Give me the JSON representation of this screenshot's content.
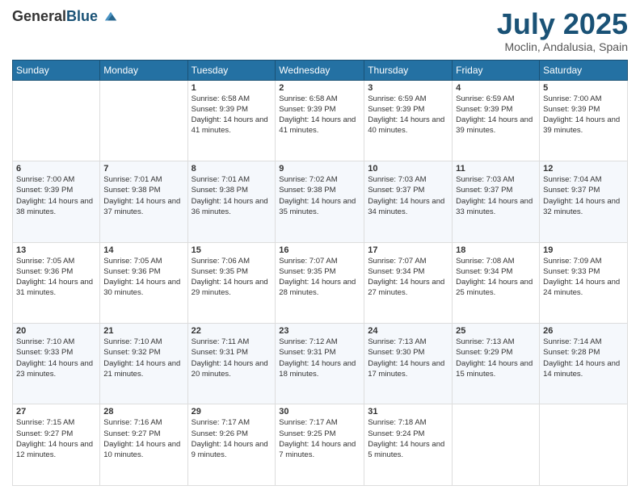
{
  "header": {
    "logo": {
      "general": "General",
      "blue": "Blue"
    },
    "title": "July 2025",
    "location": "Moclin, Andalusia, Spain"
  },
  "weekdays": [
    "Sunday",
    "Monday",
    "Tuesday",
    "Wednesday",
    "Thursday",
    "Friday",
    "Saturday"
  ],
  "weeks": [
    [
      {
        "day": "",
        "sunrise": "",
        "sunset": "",
        "daylight": ""
      },
      {
        "day": "",
        "sunrise": "",
        "sunset": "",
        "daylight": ""
      },
      {
        "day": "1",
        "sunrise": "Sunrise: 6:58 AM",
        "sunset": "Sunset: 9:39 PM",
        "daylight": "Daylight: 14 hours and 41 minutes."
      },
      {
        "day": "2",
        "sunrise": "Sunrise: 6:58 AM",
        "sunset": "Sunset: 9:39 PM",
        "daylight": "Daylight: 14 hours and 41 minutes."
      },
      {
        "day": "3",
        "sunrise": "Sunrise: 6:59 AM",
        "sunset": "Sunset: 9:39 PM",
        "daylight": "Daylight: 14 hours and 40 minutes."
      },
      {
        "day": "4",
        "sunrise": "Sunrise: 6:59 AM",
        "sunset": "Sunset: 9:39 PM",
        "daylight": "Daylight: 14 hours and 39 minutes."
      },
      {
        "day": "5",
        "sunrise": "Sunrise: 7:00 AM",
        "sunset": "Sunset: 9:39 PM",
        "daylight": "Daylight: 14 hours and 39 minutes."
      }
    ],
    [
      {
        "day": "6",
        "sunrise": "Sunrise: 7:00 AM",
        "sunset": "Sunset: 9:39 PM",
        "daylight": "Daylight: 14 hours and 38 minutes."
      },
      {
        "day": "7",
        "sunrise": "Sunrise: 7:01 AM",
        "sunset": "Sunset: 9:38 PM",
        "daylight": "Daylight: 14 hours and 37 minutes."
      },
      {
        "day": "8",
        "sunrise": "Sunrise: 7:01 AM",
        "sunset": "Sunset: 9:38 PM",
        "daylight": "Daylight: 14 hours and 36 minutes."
      },
      {
        "day": "9",
        "sunrise": "Sunrise: 7:02 AM",
        "sunset": "Sunset: 9:38 PM",
        "daylight": "Daylight: 14 hours and 35 minutes."
      },
      {
        "day": "10",
        "sunrise": "Sunrise: 7:03 AM",
        "sunset": "Sunset: 9:37 PM",
        "daylight": "Daylight: 14 hours and 34 minutes."
      },
      {
        "day": "11",
        "sunrise": "Sunrise: 7:03 AM",
        "sunset": "Sunset: 9:37 PM",
        "daylight": "Daylight: 14 hours and 33 minutes."
      },
      {
        "day": "12",
        "sunrise": "Sunrise: 7:04 AM",
        "sunset": "Sunset: 9:37 PM",
        "daylight": "Daylight: 14 hours and 32 minutes."
      }
    ],
    [
      {
        "day": "13",
        "sunrise": "Sunrise: 7:05 AM",
        "sunset": "Sunset: 9:36 PM",
        "daylight": "Daylight: 14 hours and 31 minutes."
      },
      {
        "day": "14",
        "sunrise": "Sunrise: 7:05 AM",
        "sunset": "Sunset: 9:36 PM",
        "daylight": "Daylight: 14 hours and 30 minutes."
      },
      {
        "day": "15",
        "sunrise": "Sunrise: 7:06 AM",
        "sunset": "Sunset: 9:35 PM",
        "daylight": "Daylight: 14 hours and 29 minutes."
      },
      {
        "day": "16",
        "sunrise": "Sunrise: 7:07 AM",
        "sunset": "Sunset: 9:35 PM",
        "daylight": "Daylight: 14 hours and 28 minutes."
      },
      {
        "day": "17",
        "sunrise": "Sunrise: 7:07 AM",
        "sunset": "Sunset: 9:34 PM",
        "daylight": "Daylight: 14 hours and 27 minutes."
      },
      {
        "day": "18",
        "sunrise": "Sunrise: 7:08 AM",
        "sunset": "Sunset: 9:34 PM",
        "daylight": "Daylight: 14 hours and 25 minutes."
      },
      {
        "day": "19",
        "sunrise": "Sunrise: 7:09 AM",
        "sunset": "Sunset: 9:33 PM",
        "daylight": "Daylight: 14 hours and 24 minutes."
      }
    ],
    [
      {
        "day": "20",
        "sunrise": "Sunrise: 7:10 AM",
        "sunset": "Sunset: 9:33 PM",
        "daylight": "Daylight: 14 hours and 23 minutes."
      },
      {
        "day": "21",
        "sunrise": "Sunrise: 7:10 AM",
        "sunset": "Sunset: 9:32 PM",
        "daylight": "Daylight: 14 hours and 21 minutes."
      },
      {
        "day": "22",
        "sunrise": "Sunrise: 7:11 AM",
        "sunset": "Sunset: 9:31 PM",
        "daylight": "Daylight: 14 hours and 20 minutes."
      },
      {
        "day": "23",
        "sunrise": "Sunrise: 7:12 AM",
        "sunset": "Sunset: 9:31 PM",
        "daylight": "Daylight: 14 hours and 18 minutes."
      },
      {
        "day": "24",
        "sunrise": "Sunrise: 7:13 AM",
        "sunset": "Sunset: 9:30 PM",
        "daylight": "Daylight: 14 hours and 17 minutes."
      },
      {
        "day": "25",
        "sunrise": "Sunrise: 7:13 AM",
        "sunset": "Sunset: 9:29 PM",
        "daylight": "Daylight: 14 hours and 15 minutes."
      },
      {
        "day": "26",
        "sunrise": "Sunrise: 7:14 AM",
        "sunset": "Sunset: 9:28 PM",
        "daylight": "Daylight: 14 hours and 14 minutes."
      }
    ],
    [
      {
        "day": "27",
        "sunrise": "Sunrise: 7:15 AM",
        "sunset": "Sunset: 9:27 PM",
        "daylight": "Daylight: 14 hours and 12 minutes."
      },
      {
        "day": "28",
        "sunrise": "Sunrise: 7:16 AM",
        "sunset": "Sunset: 9:27 PM",
        "daylight": "Daylight: 14 hours and 10 minutes."
      },
      {
        "day": "29",
        "sunrise": "Sunrise: 7:17 AM",
        "sunset": "Sunset: 9:26 PM",
        "daylight": "Daylight: 14 hours and 9 minutes."
      },
      {
        "day": "30",
        "sunrise": "Sunrise: 7:17 AM",
        "sunset": "Sunset: 9:25 PM",
        "daylight": "Daylight: 14 hours and 7 minutes."
      },
      {
        "day": "31",
        "sunrise": "Sunrise: 7:18 AM",
        "sunset": "Sunset: 9:24 PM",
        "daylight": "Daylight: 14 hours and 5 minutes."
      },
      {
        "day": "",
        "sunrise": "",
        "sunset": "",
        "daylight": ""
      },
      {
        "day": "",
        "sunrise": "",
        "sunset": "",
        "daylight": ""
      }
    ]
  ]
}
